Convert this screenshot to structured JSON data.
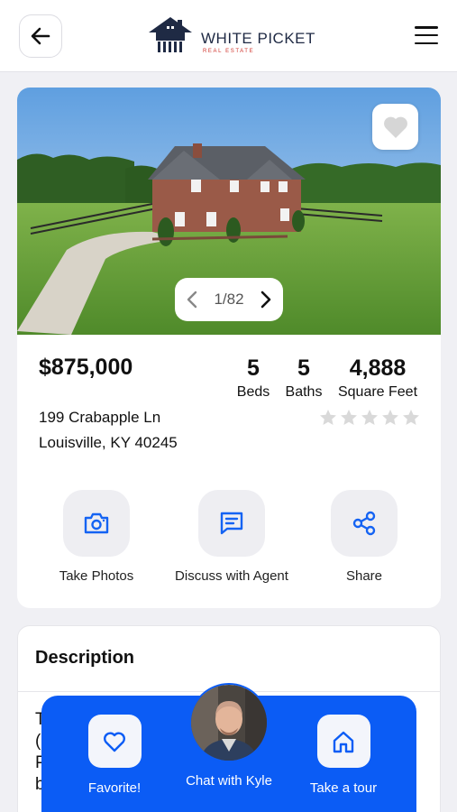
{
  "header": {
    "back_icon": "arrow-left-icon",
    "logo_title": "WHITE PICKET",
    "logo_subtitle": "REAL ESTATE",
    "menu_icon": "hamburger-menu-icon"
  },
  "gallery": {
    "current": "1/82",
    "prev_icon": "chevron-left-icon",
    "next_icon": "chevron-right-icon",
    "favorite_icon": "heart-icon"
  },
  "listing": {
    "price": "$875,000",
    "address_line1": "199 Crabapple Ln",
    "address_line2": "Louisville, KY 40245",
    "beds_value": "5",
    "beds_label": "Beds",
    "baths_value": "5",
    "baths_label": "Baths",
    "sqft_value": "4,888",
    "sqft_label": "Square Feet",
    "rating": 0,
    "rating_max": 5
  },
  "actions": {
    "take_photos": "Take Photos",
    "discuss": "Discuss with Agent",
    "share": "Share"
  },
  "description": {
    "title": "Description",
    "visible_text": "T\n(\nP\nb"
  },
  "bottom_bar": {
    "favorite": "Favorite!",
    "chat": "Chat with Kyle",
    "tour": "Take a tour"
  },
  "colors": {
    "accent": "#0b5cf5",
    "brand_navy": "#1f2a44",
    "brand_red": "#d0342c",
    "star_empty": "#d9d9d9"
  }
}
